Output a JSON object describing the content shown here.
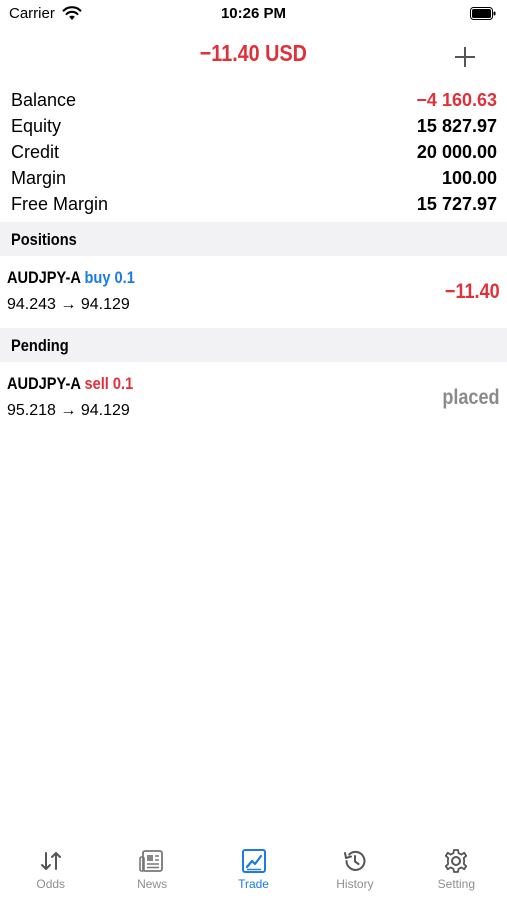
{
  "status_bar": {
    "carrier": "Carrier",
    "time": "10:26 PM"
  },
  "header": {
    "total": "−11.40 USD",
    "add_icon": "plus-icon"
  },
  "summary": [
    {
      "label": "Balance",
      "value": "−4 160.63",
      "negative": true
    },
    {
      "label": "Equity",
      "value": "15 827.97",
      "negative": false
    },
    {
      "label": "Credit",
      "value": "20 000.00",
      "negative": false
    },
    {
      "label": "Margin",
      "value": "100.00",
      "negative": false
    },
    {
      "label": "Free Margin",
      "value": "15 727.97",
      "negative": false
    }
  ],
  "positions": {
    "title": "Positions",
    "items": [
      {
        "symbol": "AUDJPY-A",
        "side": "buy 0.1",
        "prices": "94.243 → 94.129",
        "profit": "−11.40"
      }
    ]
  },
  "pending": {
    "title": "Pending",
    "items": [
      {
        "symbol": "AUDJPY-A",
        "side": "sell 0.1",
        "prices": "95.218 → 94.129",
        "state": "placed"
      }
    ]
  },
  "tabs": [
    {
      "label": "Odds",
      "icon": "sort-arrows-icon"
    },
    {
      "label": "News",
      "icon": "newspaper-icon"
    },
    {
      "label": "Trade",
      "icon": "chart-icon",
      "active": true
    },
    {
      "label": "History",
      "icon": "history-clock-icon"
    },
    {
      "label": "Setting",
      "icon": "gear-icon"
    }
  ],
  "colors": {
    "accent": "#1a7be6",
    "negative": "#e0313a",
    "muted": "#8a8a8a",
    "section_bg": "#f2f2f4"
  }
}
